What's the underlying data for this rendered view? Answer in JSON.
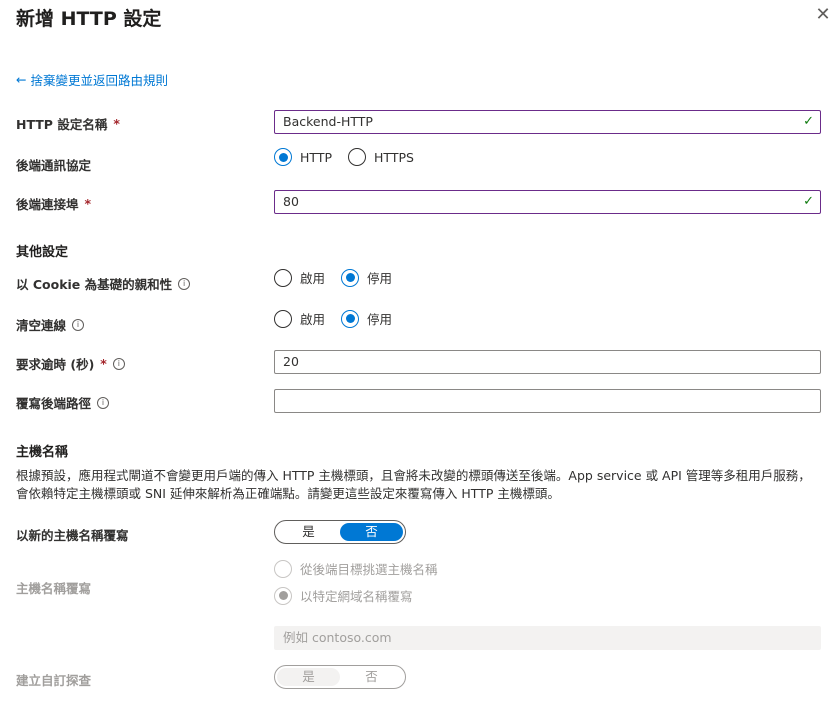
{
  "header": {
    "title": "新增 HTTP 設定",
    "close_glyph": "✕"
  },
  "back_link": {
    "arrow": "←",
    "label": "捨棄變更並返回路由規則"
  },
  "fields": {
    "http_name": {
      "label": "HTTP 設定名稱",
      "required": "*",
      "value": "Backend-HTTP",
      "check": "✓"
    },
    "protocol": {
      "label": "後端通訊協定",
      "options": [
        "HTTP",
        "HTTPS"
      ],
      "selected": "HTTP"
    },
    "port": {
      "label": "後端連接埠",
      "required": "*",
      "value": "80",
      "check": "✓"
    }
  },
  "additional": {
    "section_title": "其他設定",
    "cookie_affinity": {
      "label": "以 Cookie 為基礎的親和性",
      "info": "i",
      "options": [
        "啟用",
        "停用"
      ],
      "selected": "停用"
    },
    "connection_draining": {
      "label": "清空連線",
      "info": "i",
      "options": [
        "啟用",
        "停用"
      ],
      "selected": "停用"
    },
    "request_timeout": {
      "label": "要求逾時 (秒)",
      "required": "*",
      "info": "i",
      "value": "20"
    },
    "override_path": {
      "label": "覆寫後端路徑",
      "info": "i",
      "value": ""
    }
  },
  "host": {
    "section_title": "主機名稱",
    "description": "根據預設，應用程式閘道不會變更用戶端的傳入 HTTP 主機標頭，且會將未改變的標頭傳送至後端。App service 或 API 管理等多租用戶服務，會依賴特定主機標頭或 SNI 延伸來解析為正確端點。請變更這些設定來覆寫傳入 HTTP 主機標頭。",
    "override_new": {
      "label": "以新的主機名稱覆寫",
      "options": [
        "是",
        "否"
      ],
      "selected": "否"
    },
    "host_override": {
      "label": "主機名稱覆寫",
      "options": [
        "從後端目標挑選主機名稱",
        "以特定網域名稱覆寫"
      ],
      "selected": "以特定網域名稱覆寫"
    },
    "domain_input": {
      "placeholder": "例如 contoso.com"
    },
    "custom_probe": {
      "label": "建立自訂探查",
      "options": [
        "是",
        "否"
      ],
      "selected": "是"
    }
  }
}
